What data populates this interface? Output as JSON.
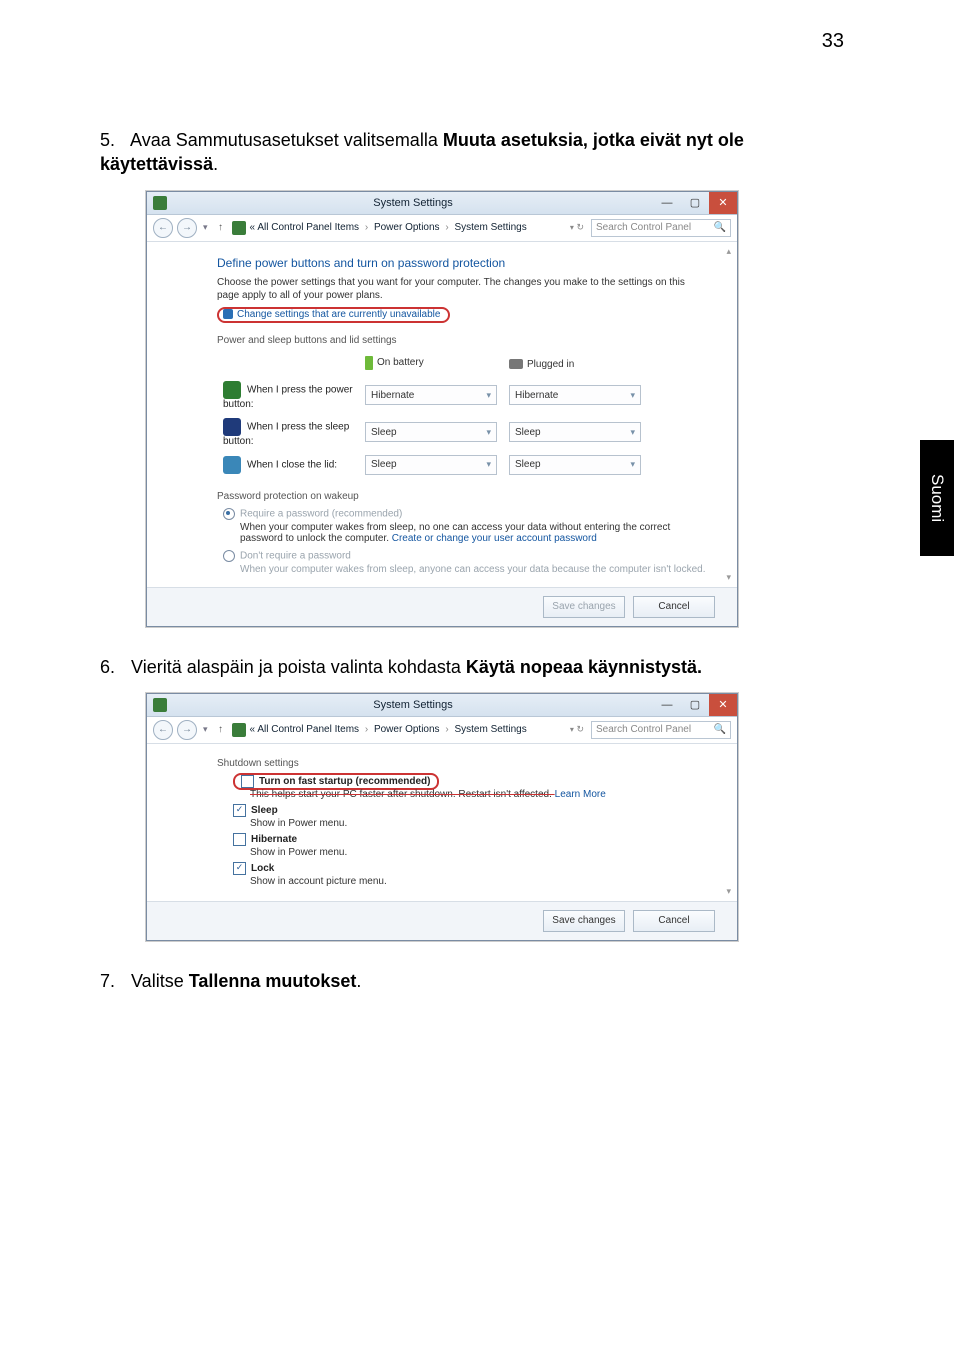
{
  "page_number": "33",
  "side_tab": "Suomi",
  "steps": {
    "s5_num": "5.",
    "s5_txt_a": "Avaa Sammutusasetukset valitsemalla ",
    "s5_txt_b": "Muuta asetuksia, jotka eivät nyt ole käytettävissä",
    "s5_txt_c": ".",
    "s6_num": "6.",
    "s6_txt_a": "Vieritä alaspäin ja poista valinta kohdasta ",
    "s6_txt_b": "Käytä nopeaa käynnistystä.",
    "s7_num": "7.",
    "s7_txt_a": "Valitse ",
    "s7_txt_b": "Tallenna muutokset",
    "s7_txt_c": "."
  },
  "win_common": {
    "title": "System Settings",
    "min": "—",
    "max": "▢",
    "close": "✕",
    "back": "←",
    "fwd": "→",
    "drop": "▾",
    "up": "↑",
    "crumb_pre": "«",
    "crumb_1": "All Control Panel Items",
    "crumb_2": "Power Options",
    "crumb_3": "System Settings",
    "sep": "›",
    "vC_caret": "▾",
    "vC_ref": "↻",
    "search_ph": "Search Control Panel",
    "search_icon": "🔍",
    "scroll_up": "▴",
    "scroll_dn": "▾",
    "save": "Save changes",
    "cancel": "Cancel"
  },
  "win1": {
    "heading": "Define power buttons and turn on password protection",
    "desc": "Choose the power settings that you want for your computer. The changes you make to the settings on this page apply to all of your power plans.",
    "ring_link": "Change settings that are currently unavailable",
    "grp1": "Power and sleep buttons and lid settings",
    "col_bat": "On battery",
    "col_plug": "Plugged in",
    "rows": [
      {
        "label": "When I press the power button:",
        "bat": "Hibernate",
        "plug": "Hibernate"
      },
      {
        "label": "When I press the sleep button:",
        "bat": "Sleep",
        "plug": "Sleep"
      },
      {
        "label": "When I close the lid:",
        "bat": "Sleep",
        "plug": "Sleep"
      }
    ],
    "grp2": "Password protection on wakeup",
    "r1_label": "Require a password (recommended)",
    "r1_desc_a": "When your computer wakes from sleep, no one can access your data without entering the correct password to unlock the computer. ",
    "r1_link": "Create or change your user account password",
    "r2_label": "Don't require a password",
    "r2_desc": "When your computer wakes from sleep, anyone can access your data because the computer isn't locked."
  },
  "win2": {
    "grp": "Shutdown settings",
    "opt_fast": "Turn on fast startup (recommended)",
    "opt_fast_sub_a": "This helps start your PC faster after shutdown. Restart isn't affected. ",
    "opt_fast_link": "Learn More",
    "opt_sleep": "Sleep",
    "opt_sleep_sub": "Show in Power menu.",
    "opt_hib": "Hibernate",
    "opt_hib_sub": "Show in Power menu.",
    "opt_lock": "Lock",
    "opt_lock_sub": "Show in account picture menu."
  }
}
